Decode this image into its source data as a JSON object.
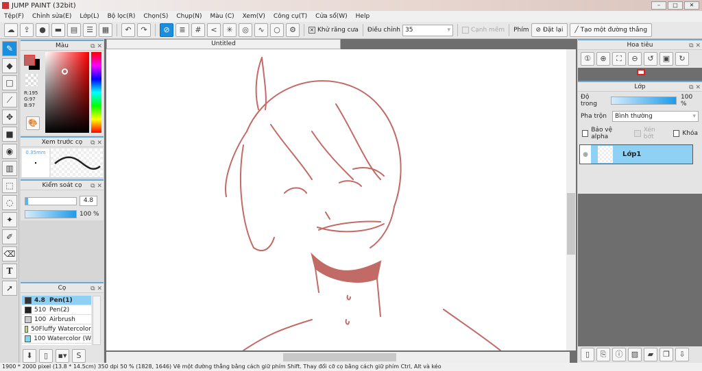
{
  "window": {
    "title": "JUMP PAINT (32bit)"
  },
  "menu": [
    "Tệp(F)",
    "Chỉnh sửa(E)",
    "Lớp(L)",
    "Bộ lọc(R)",
    "Chọn(S)",
    "Chụp(N)",
    "Màu (C)",
    "Xem(V)",
    "Công cụ(T)",
    "Cửa sổ(W)",
    "Help"
  ],
  "toolbar": {
    "antialias_label": "Khử răng cưa",
    "adjust_label": "Điều chỉnh",
    "adjust_value": "35",
    "edge_label": "Cạnh mềm",
    "key_label": "Phím",
    "reset_label": "Đặt lại",
    "line_label": "Tạo một đường thẳng"
  },
  "color_panel": {
    "title": "Màu",
    "r": "R:195",
    "g": "G:97",
    "b": "B:97",
    "fg": "#c36161",
    "bg": "#000000"
  },
  "brush_preview": {
    "title": "Xem trước cọ",
    "size": "0.35mm"
  },
  "brush_control": {
    "title": "Kiểm soát cọ",
    "size": "4.8",
    "opacity": "100 %",
    "opacity_value": 100
  },
  "brushes": {
    "title": "Cọ",
    "items": [
      {
        "size": "4.8",
        "name": "Pen(1)",
        "color": "#333333",
        "selected": true
      },
      {
        "size": "510",
        "name": "Pen(2)",
        "color": "#222222"
      },
      {
        "size": "100",
        "name": "Airbrush",
        "color": "#cccccc"
      },
      {
        "size": "50",
        "name": "Fluffy Watercolor",
        "color": "#b8e070"
      },
      {
        "size": "100",
        "name": "Watercolor (W",
        "color": "#7dd8f0"
      }
    ]
  },
  "document": {
    "tab": "Untitled"
  },
  "navigator": {
    "title": "Hoa tiêu"
  },
  "layers": {
    "title": "Lớp",
    "opacity_label": "Độ trong",
    "opacity": "100 %",
    "opacity_value": 100,
    "blend_label": "Pha trộn",
    "blend_value": "Bình thường",
    "protect_alpha": "Bảo vệ alpha",
    "clip": "Xén bớt",
    "lock": "Khóa",
    "items": [
      {
        "name": "Lớp1"
      }
    ]
  },
  "status": "1900 * 2000 pixel (13.8 * 14.5cm) 350 dpi 50 % (1828, 1646) Vẽ một đường thẳng bằng cách giữ phím Shift. Thay đổi cỡ cọ bằng cách giữ phím Ctrl, Alt và kéo"
}
